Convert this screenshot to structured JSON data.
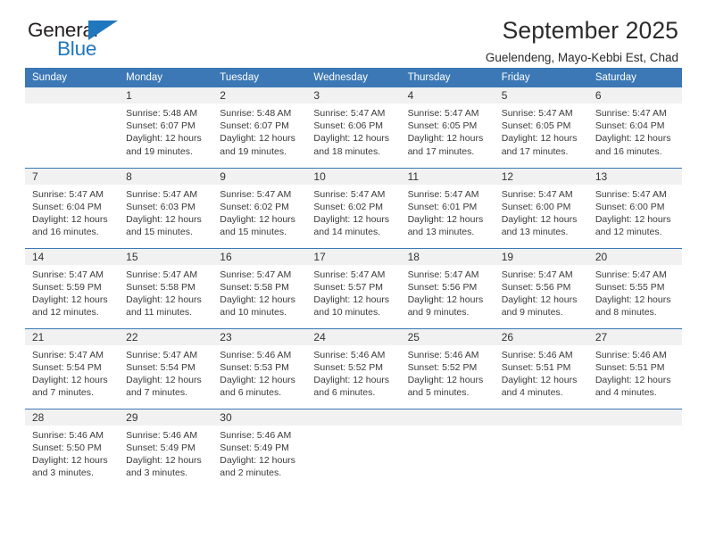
{
  "brand": {
    "name_top": "General",
    "name_bottom": "Blue",
    "color_blue": "#1f77bd",
    "color_dark": "#231f20",
    "triangle_icon": "triangle-icon"
  },
  "header": {
    "title": "September 2025",
    "subtitle": "Guelendeng, Mayo-Kebbi Est, Chad",
    "accent_color": "#3b78b5",
    "daynum_band_color": "#f1f1f1"
  },
  "weekdays": [
    "Sunday",
    "Monday",
    "Tuesday",
    "Wednesday",
    "Thursday",
    "Friday",
    "Saturday"
  ],
  "labels": {
    "sunrise_prefix": "Sunrise: ",
    "sunset_prefix": "Sunset: ",
    "daylight_prefix": "Daylight: "
  },
  "weeks": [
    [
      {
        "day": "",
        "empty": true
      },
      {
        "day": "1",
        "sunrise": "Sunrise: 5:48 AM",
        "sunset": "Sunset: 6:07 PM",
        "daylight": "Daylight: 12 hours and 19 minutes."
      },
      {
        "day": "2",
        "sunrise": "Sunrise: 5:48 AM",
        "sunset": "Sunset: 6:07 PM",
        "daylight": "Daylight: 12 hours and 19 minutes."
      },
      {
        "day": "3",
        "sunrise": "Sunrise: 5:47 AM",
        "sunset": "Sunset: 6:06 PM",
        "daylight": "Daylight: 12 hours and 18 minutes."
      },
      {
        "day": "4",
        "sunrise": "Sunrise: 5:47 AM",
        "sunset": "Sunset: 6:05 PM",
        "daylight": "Daylight: 12 hours and 17 minutes."
      },
      {
        "day": "5",
        "sunrise": "Sunrise: 5:47 AM",
        "sunset": "Sunset: 6:05 PM",
        "daylight": "Daylight: 12 hours and 17 minutes."
      },
      {
        "day": "6",
        "sunrise": "Sunrise: 5:47 AM",
        "sunset": "Sunset: 6:04 PM",
        "daylight": "Daylight: 12 hours and 16 minutes."
      }
    ],
    [
      {
        "day": "7",
        "sunrise": "Sunrise: 5:47 AM",
        "sunset": "Sunset: 6:04 PM",
        "daylight": "Daylight: 12 hours and 16 minutes."
      },
      {
        "day": "8",
        "sunrise": "Sunrise: 5:47 AM",
        "sunset": "Sunset: 6:03 PM",
        "daylight": "Daylight: 12 hours and 15 minutes."
      },
      {
        "day": "9",
        "sunrise": "Sunrise: 5:47 AM",
        "sunset": "Sunset: 6:02 PM",
        "daylight": "Daylight: 12 hours and 15 minutes."
      },
      {
        "day": "10",
        "sunrise": "Sunrise: 5:47 AM",
        "sunset": "Sunset: 6:02 PM",
        "daylight": "Daylight: 12 hours and 14 minutes."
      },
      {
        "day": "11",
        "sunrise": "Sunrise: 5:47 AM",
        "sunset": "Sunset: 6:01 PM",
        "daylight": "Daylight: 12 hours and 13 minutes."
      },
      {
        "day": "12",
        "sunrise": "Sunrise: 5:47 AM",
        "sunset": "Sunset: 6:00 PM",
        "daylight": "Daylight: 12 hours and 13 minutes."
      },
      {
        "day": "13",
        "sunrise": "Sunrise: 5:47 AM",
        "sunset": "Sunset: 6:00 PM",
        "daylight": "Daylight: 12 hours and 12 minutes."
      }
    ],
    [
      {
        "day": "14",
        "sunrise": "Sunrise: 5:47 AM",
        "sunset": "Sunset: 5:59 PM",
        "daylight": "Daylight: 12 hours and 12 minutes."
      },
      {
        "day": "15",
        "sunrise": "Sunrise: 5:47 AM",
        "sunset": "Sunset: 5:58 PM",
        "daylight": "Daylight: 12 hours and 11 minutes."
      },
      {
        "day": "16",
        "sunrise": "Sunrise: 5:47 AM",
        "sunset": "Sunset: 5:58 PM",
        "daylight": "Daylight: 12 hours and 10 minutes."
      },
      {
        "day": "17",
        "sunrise": "Sunrise: 5:47 AM",
        "sunset": "Sunset: 5:57 PM",
        "daylight": "Daylight: 12 hours and 10 minutes."
      },
      {
        "day": "18",
        "sunrise": "Sunrise: 5:47 AM",
        "sunset": "Sunset: 5:56 PM",
        "daylight": "Daylight: 12 hours and 9 minutes."
      },
      {
        "day": "19",
        "sunrise": "Sunrise: 5:47 AM",
        "sunset": "Sunset: 5:56 PM",
        "daylight": "Daylight: 12 hours and 9 minutes."
      },
      {
        "day": "20",
        "sunrise": "Sunrise: 5:47 AM",
        "sunset": "Sunset: 5:55 PM",
        "daylight": "Daylight: 12 hours and 8 minutes."
      }
    ],
    [
      {
        "day": "21",
        "sunrise": "Sunrise: 5:47 AM",
        "sunset": "Sunset: 5:54 PM",
        "daylight": "Daylight: 12 hours and 7 minutes."
      },
      {
        "day": "22",
        "sunrise": "Sunrise: 5:47 AM",
        "sunset": "Sunset: 5:54 PM",
        "daylight": "Daylight: 12 hours and 7 minutes."
      },
      {
        "day": "23",
        "sunrise": "Sunrise: 5:46 AM",
        "sunset": "Sunset: 5:53 PM",
        "daylight": "Daylight: 12 hours and 6 minutes."
      },
      {
        "day": "24",
        "sunrise": "Sunrise: 5:46 AM",
        "sunset": "Sunset: 5:52 PM",
        "daylight": "Daylight: 12 hours and 6 minutes."
      },
      {
        "day": "25",
        "sunrise": "Sunrise: 5:46 AM",
        "sunset": "Sunset: 5:52 PM",
        "daylight": "Daylight: 12 hours and 5 minutes."
      },
      {
        "day": "26",
        "sunrise": "Sunrise: 5:46 AM",
        "sunset": "Sunset: 5:51 PM",
        "daylight": "Daylight: 12 hours and 4 minutes."
      },
      {
        "day": "27",
        "sunrise": "Sunrise: 5:46 AM",
        "sunset": "Sunset: 5:51 PM",
        "daylight": "Daylight: 12 hours and 4 minutes."
      }
    ],
    [
      {
        "day": "28",
        "sunrise": "Sunrise: 5:46 AM",
        "sunset": "Sunset: 5:50 PM",
        "daylight": "Daylight: 12 hours and 3 minutes."
      },
      {
        "day": "29",
        "sunrise": "Sunrise: 5:46 AM",
        "sunset": "Sunset: 5:49 PM",
        "daylight": "Daylight: 12 hours and 3 minutes."
      },
      {
        "day": "30",
        "sunrise": "Sunrise: 5:46 AM",
        "sunset": "Sunset: 5:49 PM",
        "daylight": "Daylight: 12 hours and 2 minutes."
      },
      {
        "day": "",
        "empty": true
      },
      {
        "day": "",
        "empty": true
      },
      {
        "day": "",
        "empty": true
      },
      {
        "day": "",
        "empty": true
      }
    ]
  ]
}
